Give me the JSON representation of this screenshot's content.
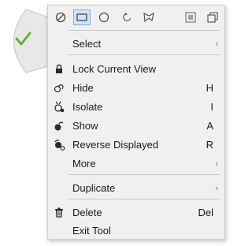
{
  "colors": {
    "wedge": "#e8e8e8",
    "check": "#5cb82a",
    "menu_bg": "#f0f0f0",
    "active_tool_bg": "#cfe3f7",
    "icon": "#4a4a4a"
  },
  "toolbar": {
    "tools": [
      {
        "name": "none-select-icon",
        "active": false
      },
      {
        "name": "rectangle-select-icon",
        "active": true
      },
      {
        "name": "circle-select-icon",
        "active": false
      },
      {
        "name": "lasso-select-icon",
        "active": false
      },
      {
        "name": "polygon-select-icon",
        "active": false
      },
      {
        "name": "window-select-icon",
        "active": false
      },
      {
        "name": "crossing-select-icon",
        "active": false
      }
    ]
  },
  "menu": {
    "select": {
      "label": "Select",
      "arrow": "›"
    },
    "lock_view": {
      "label": "Lock Current View",
      "icon": "lock-icon"
    },
    "hide": {
      "label": "Hide",
      "shortcut": "H",
      "icon": "hide-icon"
    },
    "isolate": {
      "label": "Isolate",
      "shortcut": "I",
      "icon": "isolate-icon"
    },
    "show": {
      "label": "Show",
      "shortcut": "A",
      "icon": "show-icon"
    },
    "reverse_displayed": {
      "label": "Reverse Displayed",
      "shortcut": "R",
      "icon": "reverse-displayed-icon"
    },
    "more": {
      "label": "More",
      "arrow": "›"
    },
    "duplicate": {
      "label": "Duplicate",
      "arrow": "›"
    },
    "delete": {
      "label": "Delete",
      "shortcut": "Del",
      "icon": "trash-icon"
    },
    "exit_tool": {
      "label": "Exit Tool"
    }
  }
}
